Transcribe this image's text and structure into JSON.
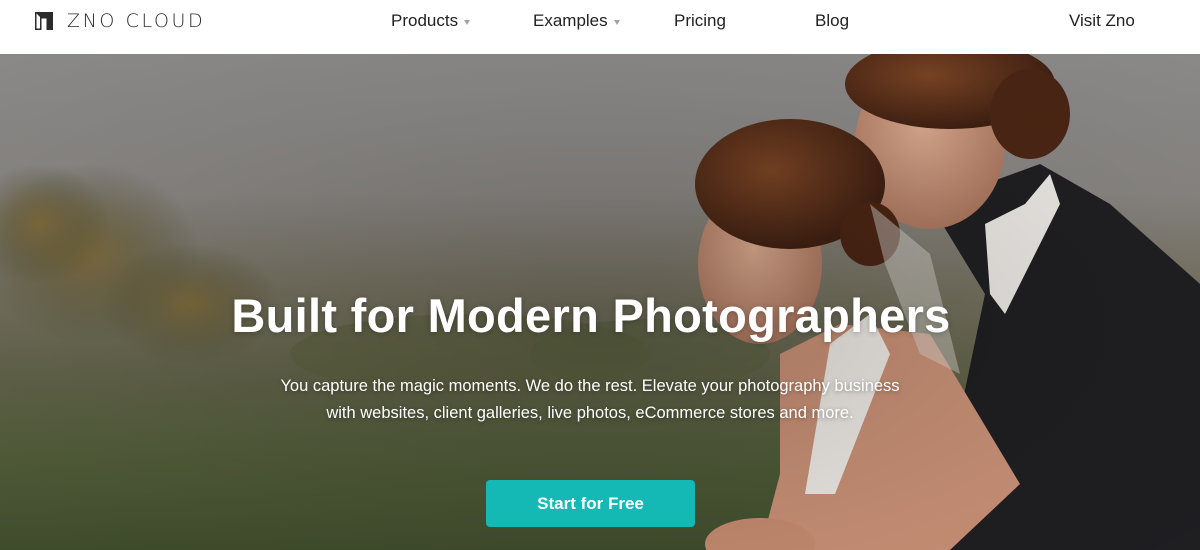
{
  "brand": {
    "logo_text": "ZNO CLOUD",
    "logo_icon": "zno-logo-icon"
  },
  "nav": {
    "items": [
      {
        "label": "Products",
        "has_dropdown": true
      },
      {
        "label": "Examples",
        "has_dropdown": true
      },
      {
        "label": "Pricing",
        "has_dropdown": false
      },
      {
        "label": "Blog",
        "has_dropdown": false
      }
    ],
    "visit_link": "Visit Zno"
  },
  "hero": {
    "title": "Built for Modern Photographers",
    "subtitle_line1": "You capture the magic moments. We do the rest. Elevate your photography business",
    "subtitle_line2": "with websites, client galleries, live photos, eCommerce stores and more.",
    "cta_label": "Start for Free",
    "background_image": "wedding-couple-photo"
  },
  "colors": {
    "cta": "#14b8b5",
    "nav_text": "#222222",
    "header_bg": "#ffffff",
    "hero_text": "#ffffff"
  }
}
